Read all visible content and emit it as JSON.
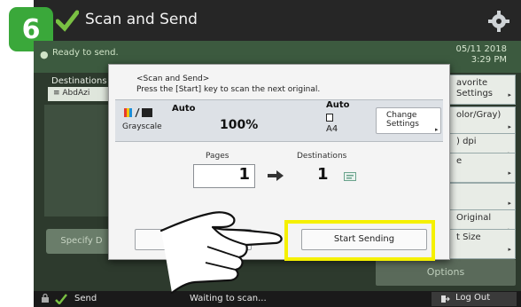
{
  "step": {
    "number": "6"
  },
  "header": {
    "title": "Scan and Send",
    "gear_icon": "gear-icon"
  },
  "status": {
    "text": "Ready to send.",
    "date": "05/11 2018",
    "time": "3:29 PM"
  },
  "destinations": {
    "label": "Destinations",
    "item": "≡ AbdAzi"
  },
  "left": {
    "specify_label": "Specify D"
  },
  "right_buttons": [
    {
      "label": "avorite\nSettings"
    },
    {
      "label": "olor/Gray)"
    },
    {
      "label": ") dpi"
    },
    {
      "label": "e"
    },
    {
      "label": ""
    },
    {
      "label": "Original"
    },
    {
      "label": "t Size"
    }
  ],
  "options": {
    "label": "Options"
  },
  "bottom": {
    "send": "Send",
    "waiting": "Waiting to scan...",
    "logout": "Log Out"
  },
  "dialog": {
    "line1": "<Scan and Send>",
    "line2": "Press the [Start] key to scan the next original.",
    "color_auto": "Auto",
    "color_mode": "Grayscale",
    "scale": "100%",
    "paper_auto": "Auto",
    "paper_size": "A4",
    "change_settings": "Change\nSettings",
    "pages_label": "Pages",
    "pages_value": "1",
    "destinations_label": "Destinations",
    "destinations_value": "1",
    "cancel": "Cancel",
    "start_sending": "Start Sending"
  },
  "colors": {
    "accent_green": "#3aa83a",
    "highlight": "#f5f000"
  }
}
